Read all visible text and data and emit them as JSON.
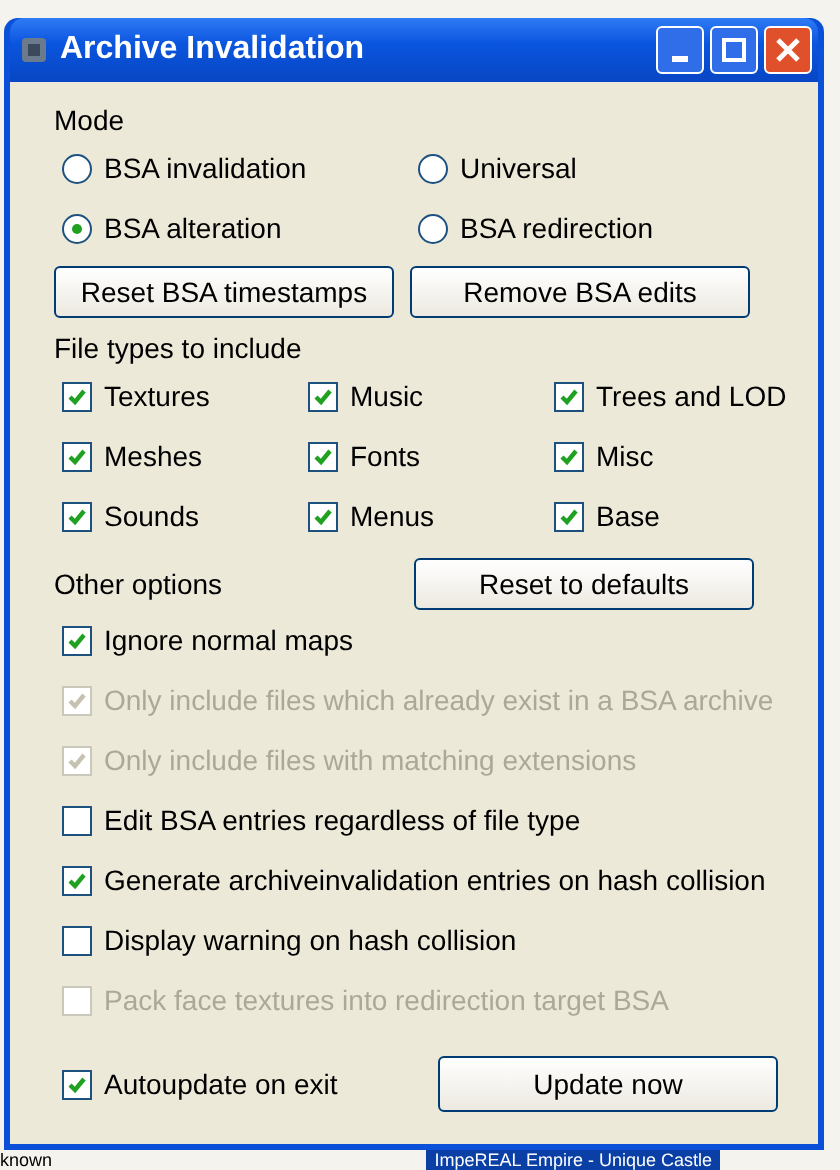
{
  "window": {
    "title": "Archive Invalidation"
  },
  "mode": {
    "label": "Mode",
    "options": [
      {
        "label": "BSA invalidation",
        "selected": false
      },
      {
        "label": "Universal",
        "selected": false
      },
      {
        "label": "BSA alteration",
        "selected": true
      },
      {
        "label": "BSA redirection",
        "selected": false
      }
    ]
  },
  "actions": [
    "Reset BSA timestamps",
    "Remove BSA edits"
  ],
  "file_types": {
    "label": "File types to include",
    "items": [
      {
        "label": "Textures",
        "checked": true
      },
      {
        "label": "Music",
        "checked": true
      },
      {
        "label": "Trees and LOD",
        "checked": true
      },
      {
        "label": "Meshes",
        "checked": true
      },
      {
        "label": "Fonts",
        "checked": true
      },
      {
        "label": "Misc",
        "checked": true
      },
      {
        "label": "Sounds",
        "checked": true
      },
      {
        "label": "Menus",
        "checked": true
      },
      {
        "label": "Base",
        "checked": true
      }
    ]
  },
  "other_options": {
    "label": "Other options",
    "reset_button": "Reset to defaults",
    "items": [
      {
        "label": "Ignore normal maps",
        "checked": true,
        "disabled": false
      },
      {
        "label": "Only include files which already exist in a BSA archive",
        "checked": true,
        "disabled": true
      },
      {
        "label": "Only include files with matching extensions",
        "checked": true,
        "disabled": true
      },
      {
        "label": "Edit BSA entries regardless of file type",
        "checked": false,
        "disabled": false
      },
      {
        "label": "Generate archiveinvalidation entries on hash collision",
        "checked": true,
        "disabled": false
      },
      {
        "label": "Display warning on hash collision",
        "checked": false,
        "disabled": false
      },
      {
        "label": "Pack face textures into redirection target BSA",
        "checked": false,
        "disabled": true
      }
    ]
  },
  "autoupdate": {
    "label": "Autoupdate on exit",
    "checked": true
  },
  "update_button": "Update now",
  "background_items": [
    "known",
    "ImpeREAL Empire - Unique Castle"
  ]
}
